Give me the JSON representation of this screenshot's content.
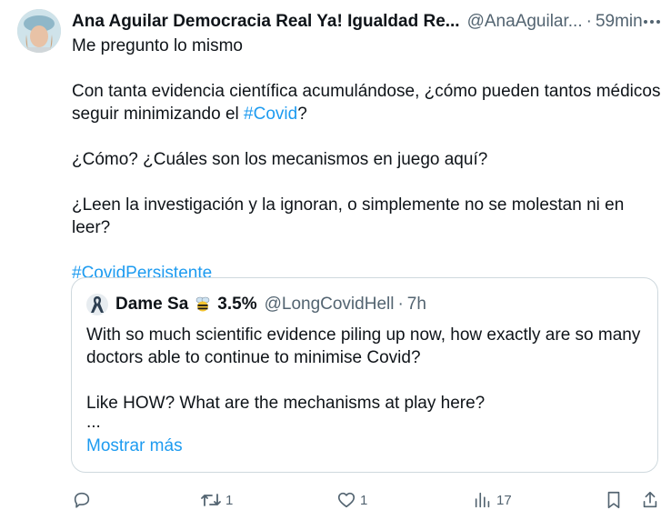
{
  "tweet": {
    "author_name": "Ana Aguilar Democracia Real Ya! Igualdad Re...",
    "handle": "@AnaAguilar...",
    "separator": "·",
    "time": "59min",
    "paragraphs": [
      "Me pregunto lo mismo",
      "Con tanta evidencia científica acumulándose, ¿cómo pueden tantos médicos seguir minimizando el ",
      "#Covid",
      "?",
      "¿Cómo? ¿Cuáles son los mecanismos en juego aquí?",
      "¿Leen la investigación y la ignoran, o simplemente no se molestan ni en leer?",
      "#CovidPersistente"
    ]
  },
  "quote": {
    "name": "Dame Sa",
    "emoji": "bee",
    "percent": "3.5%",
    "handle": "@LongCovidHell",
    "separator": "·",
    "time": "7h",
    "line1": "With so much scientific evidence piling up now, how exactly are so many doctors able to continue to minimise Covid?",
    "line2": "Like HOW? What are the mechanisms at play here?",
    "ellipsis": "...",
    "show_more": "Mostrar más"
  },
  "actions": {
    "reply_icon": "reply-icon",
    "retweet_count": "1",
    "like_count": "1",
    "views_count": "17",
    "bookmark_icon": "bookmark-icon",
    "share_icon": "share-icon"
  },
  "colors": {
    "link": "#1d9bf0",
    "muted": "#536471",
    "text": "#0f1419",
    "border": "#cfd9de"
  }
}
